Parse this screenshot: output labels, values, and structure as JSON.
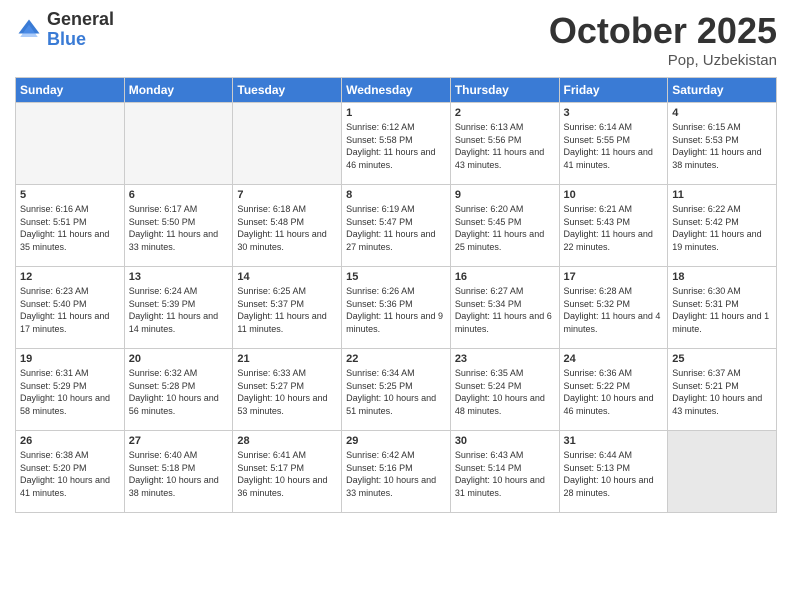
{
  "header": {
    "logo_general": "General",
    "logo_blue": "Blue",
    "title": "October 2025",
    "location": "Pop, Uzbekistan"
  },
  "weekdays": [
    "Sunday",
    "Monday",
    "Tuesday",
    "Wednesday",
    "Thursday",
    "Friday",
    "Saturday"
  ],
  "weeks": [
    [
      {
        "day": "",
        "info": "",
        "empty": true
      },
      {
        "day": "",
        "info": "",
        "empty": true
      },
      {
        "day": "",
        "info": "",
        "empty": true
      },
      {
        "day": "1",
        "info": "Sunrise: 6:12 AM\nSunset: 5:58 PM\nDaylight: 11 hours and 46 minutes.",
        "empty": false
      },
      {
        "day": "2",
        "info": "Sunrise: 6:13 AM\nSunset: 5:56 PM\nDaylight: 11 hours and 43 minutes.",
        "empty": false
      },
      {
        "day": "3",
        "info": "Sunrise: 6:14 AM\nSunset: 5:55 PM\nDaylight: 11 hours and 41 minutes.",
        "empty": false
      },
      {
        "day": "4",
        "info": "Sunrise: 6:15 AM\nSunset: 5:53 PM\nDaylight: 11 hours and 38 minutes.",
        "empty": false
      }
    ],
    [
      {
        "day": "5",
        "info": "Sunrise: 6:16 AM\nSunset: 5:51 PM\nDaylight: 11 hours and 35 minutes.",
        "empty": false
      },
      {
        "day": "6",
        "info": "Sunrise: 6:17 AM\nSunset: 5:50 PM\nDaylight: 11 hours and 33 minutes.",
        "empty": false
      },
      {
        "day": "7",
        "info": "Sunrise: 6:18 AM\nSunset: 5:48 PM\nDaylight: 11 hours and 30 minutes.",
        "empty": false
      },
      {
        "day": "8",
        "info": "Sunrise: 6:19 AM\nSunset: 5:47 PM\nDaylight: 11 hours and 27 minutes.",
        "empty": false
      },
      {
        "day": "9",
        "info": "Sunrise: 6:20 AM\nSunset: 5:45 PM\nDaylight: 11 hours and 25 minutes.",
        "empty": false
      },
      {
        "day": "10",
        "info": "Sunrise: 6:21 AM\nSunset: 5:43 PM\nDaylight: 11 hours and 22 minutes.",
        "empty": false
      },
      {
        "day": "11",
        "info": "Sunrise: 6:22 AM\nSunset: 5:42 PM\nDaylight: 11 hours and 19 minutes.",
        "empty": false
      }
    ],
    [
      {
        "day": "12",
        "info": "Sunrise: 6:23 AM\nSunset: 5:40 PM\nDaylight: 11 hours and 17 minutes.",
        "empty": false
      },
      {
        "day": "13",
        "info": "Sunrise: 6:24 AM\nSunset: 5:39 PM\nDaylight: 11 hours and 14 minutes.",
        "empty": false
      },
      {
        "day": "14",
        "info": "Sunrise: 6:25 AM\nSunset: 5:37 PM\nDaylight: 11 hours and 11 minutes.",
        "empty": false
      },
      {
        "day": "15",
        "info": "Sunrise: 6:26 AM\nSunset: 5:36 PM\nDaylight: 11 hours and 9 minutes.",
        "empty": false
      },
      {
        "day": "16",
        "info": "Sunrise: 6:27 AM\nSunset: 5:34 PM\nDaylight: 11 hours and 6 minutes.",
        "empty": false
      },
      {
        "day": "17",
        "info": "Sunrise: 6:28 AM\nSunset: 5:32 PM\nDaylight: 11 hours and 4 minutes.",
        "empty": false
      },
      {
        "day": "18",
        "info": "Sunrise: 6:30 AM\nSunset: 5:31 PM\nDaylight: 11 hours and 1 minute.",
        "empty": false
      }
    ],
    [
      {
        "day": "19",
        "info": "Sunrise: 6:31 AM\nSunset: 5:29 PM\nDaylight: 10 hours and 58 minutes.",
        "empty": false
      },
      {
        "day": "20",
        "info": "Sunrise: 6:32 AM\nSunset: 5:28 PM\nDaylight: 10 hours and 56 minutes.",
        "empty": false
      },
      {
        "day": "21",
        "info": "Sunrise: 6:33 AM\nSunset: 5:27 PM\nDaylight: 10 hours and 53 minutes.",
        "empty": false
      },
      {
        "day": "22",
        "info": "Sunrise: 6:34 AM\nSunset: 5:25 PM\nDaylight: 10 hours and 51 minutes.",
        "empty": false
      },
      {
        "day": "23",
        "info": "Sunrise: 6:35 AM\nSunset: 5:24 PM\nDaylight: 10 hours and 48 minutes.",
        "empty": false
      },
      {
        "day": "24",
        "info": "Sunrise: 6:36 AM\nSunset: 5:22 PM\nDaylight: 10 hours and 46 minutes.",
        "empty": false
      },
      {
        "day": "25",
        "info": "Sunrise: 6:37 AM\nSunset: 5:21 PM\nDaylight: 10 hours and 43 minutes.",
        "empty": false
      }
    ],
    [
      {
        "day": "26",
        "info": "Sunrise: 6:38 AM\nSunset: 5:20 PM\nDaylight: 10 hours and 41 minutes.",
        "empty": false
      },
      {
        "day": "27",
        "info": "Sunrise: 6:40 AM\nSunset: 5:18 PM\nDaylight: 10 hours and 38 minutes.",
        "empty": false
      },
      {
        "day": "28",
        "info": "Sunrise: 6:41 AM\nSunset: 5:17 PM\nDaylight: 10 hours and 36 minutes.",
        "empty": false
      },
      {
        "day": "29",
        "info": "Sunrise: 6:42 AM\nSunset: 5:16 PM\nDaylight: 10 hours and 33 minutes.",
        "empty": false
      },
      {
        "day": "30",
        "info": "Sunrise: 6:43 AM\nSunset: 5:14 PM\nDaylight: 10 hours and 31 minutes.",
        "empty": false
      },
      {
        "day": "31",
        "info": "Sunrise: 6:44 AM\nSunset: 5:13 PM\nDaylight: 10 hours and 28 minutes.",
        "empty": false
      },
      {
        "day": "",
        "info": "",
        "empty": true,
        "shaded": true
      }
    ]
  ]
}
